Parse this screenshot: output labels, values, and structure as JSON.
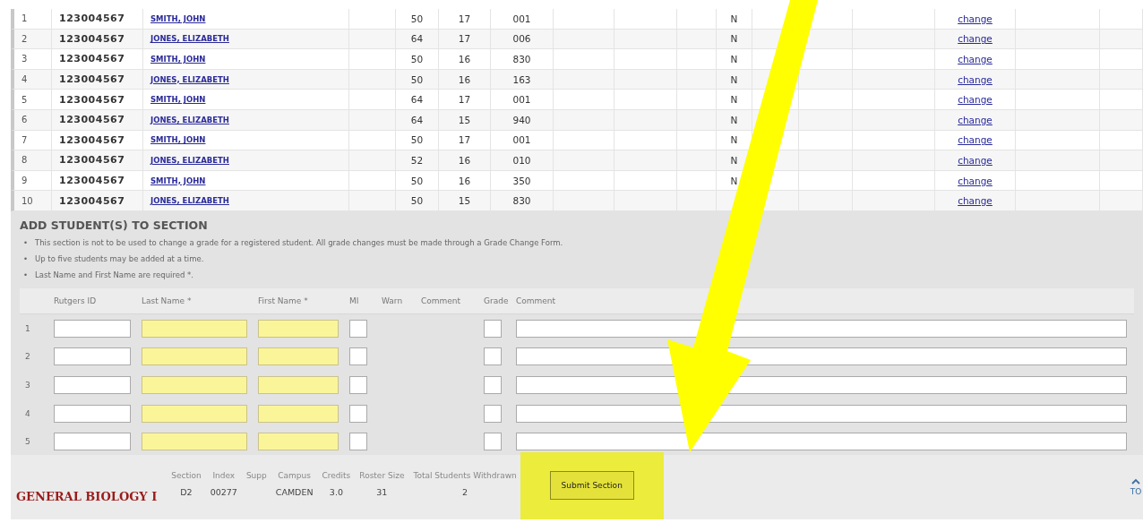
{
  "roster": {
    "rows": [
      {
        "number": "1",
        "id": "123004567",
        "name": "SMITH, JOHN",
        "col_5": "50",
        "col_6": "17",
        "col_7": "001",
        "flag": "N",
        "action": "change"
      },
      {
        "number": "2",
        "id": "123004567",
        "name": "JONES, ELIZABETH",
        "col_5": "64",
        "col_6": "17",
        "col_7": "006",
        "flag": "N",
        "action": "change"
      },
      {
        "number": "3",
        "id": "123004567",
        "name": "SMITH, JOHN",
        "col_5": "50",
        "col_6": "16",
        "col_7": "830",
        "flag": "N",
        "action": "change"
      },
      {
        "number": "4",
        "id": "123004567",
        "name": "JONES, ELIZABETH",
        "col_5": "50",
        "col_6": "16",
        "col_7": "163",
        "flag": "N",
        "action": "change"
      },
      {
        "number": "5",
        "id": "123004567",
        "name": "SMITH, JOHN",
        "col_5": "64",
        "col_6": "17",
        "col_7": "001",
        "flag": "N",
        "action": "change"
      },
      {
        "number": "6",
        "id": "123004567",
        "name": "JONES, ELIZABETH",
        "col_5": "64",
        "col_6": "15",
        "col_7": "940",
        "flag": "N",
        "action": "change"
      },
      {
        "number": "7",
        "id": "123004567",
        "name": "SMITH, JOHN",
        "col_5": "50",
        "col_6": "17",
        "col_7": "001",
        "flag": "N",
        "action": "change"
      },
      {
        "number": "8",
        "id": "123004567",
        "name": "JONES, ELIZABETH",
        "col_5": "52",
        "col_6": "16",
        "col_7": "010",
        "flag": "N",
        "action": "change"
      },
      {
        "number": "9",
        "id": "123004567",
        "name": "SMITH, JOHN",
        "col_5": "50",
        "col_6": "16",
        "col_7": "350",
        "flag": "N",
        "action": "change"
      },
      {
        "number": "10",
        "id": "123004567",
        "name": "JONES, ELIZABETH",
        "col_5": "50",
        "col_6": "15",
        "col_7": "830",
        "action": "change"
      }
    ]
  },
  "add_students": {
    "title": "ADD STUDENT(S) TO SECTION",
    "notes": [
      {
        "bullet": "•",
        "text": "This section is not to be used to change a grade for a registered student. All grade changes must be made through a Grade Change Form."
      },
      {
        "bullet": "•",
        "text": "Up to five students may be added at a time."
      },
      {
        "bullet": "•",
        "text": "Last Name and First Name are required *."
      }
    ],
    "columns": [
      {
        "label": "Rutgers ID",
        "kind": "id"
      },
      {
        "label": "Last Name *",
        "kind": "required"
      },
      {
        "label": "First Name *",
        "kind": "required-short"
      },
      {
        "label": "MI",
        "kind": "small"
      },
      {
        "label": "Warn",
        "kind": "none"
      },
      {
        "label": "Comment",
        "kind": "none-wide"
      },
      {
        "label": "Grade",
        "kind": "small"
      },
      {
        "label": "Comment",
        "kind": "wide"
      }
    ],
    "rows": [
      {
        "number": "1"
      },
      {
        "number": "2"
      },
      {
        "number": "3"
      },
      {
        "number": "4"
      },
      {
        "number": "5"
      }
    ]
  },
  "footer": {
    "course": "GENERAL BIOLOGY I",
    "fields": [
      {
        "label": "Section",
        "value": "D2"
      },
      {
        "label": "Index",
        "value": "00277"
      },
      {
        "label": "Supp"
      },
      {
        "label": "Campus",
        "value": "CAMDEN"
      },
      {
        "label": "Credits",
        "value": "3.0"
      },
      {
        "label": "Roster Size",
        "value": "31"
      },
      {
        "label": "Total Students Withdrawn",
        "value": "2"
      }
    ],
    "submit": "Submit Section",
    "top_link": "TO"
  }
}
